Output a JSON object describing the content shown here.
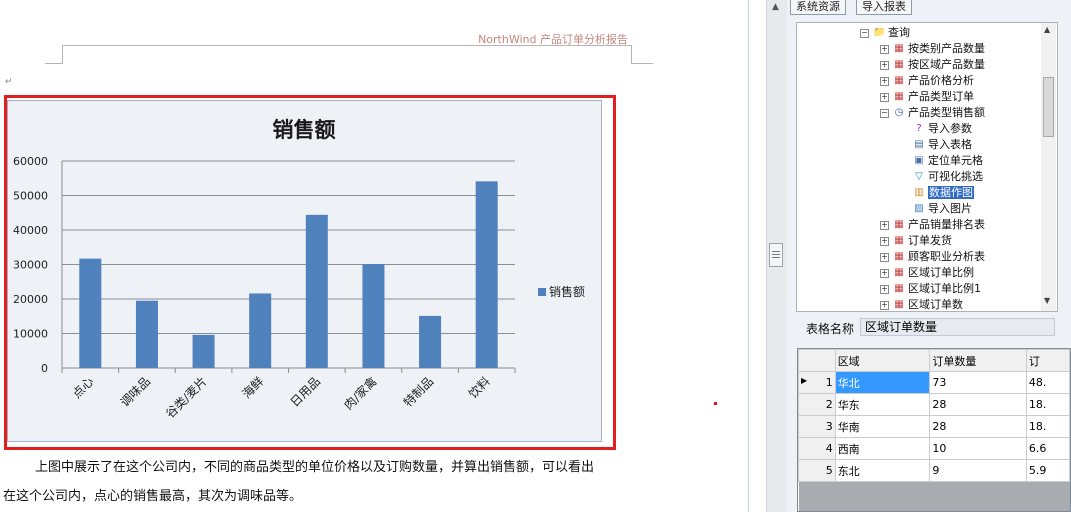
{
  "document": {
    "header_title": "NorthWind 产品订单分析报告",
    "paragraph_line1": "上图中展示了在这个公司内，不同的商品类型的单位价格以及订购数量，并算出销售额，可以看出",
    "paragraph_line2": "在这个公司内，点心的销售最高，其次为调味品等。"
  },
  "chart_data": {
    "type": "bar",
    "title": "销售额",
    "categories": [
      "点心",
      "调味品",
      "谷类/麦片",
      "海鲜",
      "日用品",
      "肉/家禽",
      "特制品",
      "饮料"
    ],
    "series": [
      {
        "name": "销售额",
        "values": [
          31700,
          19500,
          9600,
          21600,
          44400,
          30100,
          15100,
          54100
        ]
      }
    ],
    "ylim": [
      0,
      60000
    ],
    "yticks": [
      0,
      10000,
      20000,
      30000,
      40000,
      50000,
      60000
    ],
    "grid": true,
    "legend": "right",
    "bar_color": "#4f81bd"
  },
  "panel": {
    "tabs": [
      "系统资源",
      "导入报表"
    ],
    "tree": [
      {
        "label": "查询",
        "icon": "folder-icon",
        "level": 0,
        "expander": "−"
      },
      {
        "label": "按类别产品数量",
        "icon": "report-icon",
        "level": 1,
        "expander": "+"
      },
      {
        "label": "按区域产品数量",
        "icon": "report-icon",
        "level": 1,
        "expander": "+"
      },
      {
        "label": "产品价格分析",
        "icon": "report-icon",
        "level": 1,
        "expander": "+"
      },
      {
        "label": "产品类型订单",
        "icon": "report-icon",
        "level": 1,
        "expander": "+"
      },
      {
        "label": "产品类型销售额",
        "icon": "clock-icon",
        "level": 1,
        "expander": "−"
      },
      {
        "label": "导入参数",
        "icon": "question-icon",
        "level": 2,
        "expander": ""
      },
      {
        "label": "导入表格",
        "icon": "table-icon",
        "level": 2,
        "expander": ""
      },
      {
        "label": "定位单元格",
        "icon": "cell-icon",
        "level": 2,
        "expander": ""
      },
      {
        "label": "可视化挑选",
        "icon": "filter-icon",
        "level": 2,
        "expander": ""
      },
      {
        "label": "数据作图",
        "icon": "chart-icon",
        "level": 2,
        "expander": "",
        "selected": true
      },
      {
        "label": "导入图片",
        "icon": "image-icon",
        "level": 2,
        "expander": ""
      },
      {
        "label": "产品销量排名表",
        "icon": "report-icon",
        "level": 1,
        "expander": "+"
      },
      {
        "label": "订单发货",
        "icon": "report-icon",
        "level": 1,
        "expander": "+"
      },
      {
        "label": "顾客职业分析表",
        "icon": "report-icon",
        "level": 1,
        "expander": "+"
      },
      {
        "label": "区域订单比例",
        "icon": "report-icon",
        "level": 1,
        "expander": "+"
      },
      {
        "label": "区域订单比例1",
        "icon": "report-icon",
        "level": 1,
        "expander": "+"
      },
      {
        "label": "区域订单数",
        "icon": "report-icon",
        "level": 1,
        "expander": "+"
      }
    ],
    "table_name_label": "表格名称",
    "table_name_value": "区域订单数量",
    "grid": {
      "columns": [
        "区域",
        "订单数量",
        "订"
      ],
      "rows": [
        {
          "num": "1",
          "region": "华北",
          "orders": "73",
          "extra": "48.",
          "current": true
        },
        {
          "num": "2",
          "region": "华东",
          "orders": "28",
          "extra": "18."
        },
        {
          "num": "3",
          "region": "华南",
          "orders": "28",
          "extra": "18."
        },
        {
          "num": "4",
          "region": "西南",
          "orders": "10",
          "extra": "6.6"
        },
        {
          "num": "5",
          "region": "东北",
          "orders": "9",
          "extra": "5.9"
        }
      ]
    }
  }
}
